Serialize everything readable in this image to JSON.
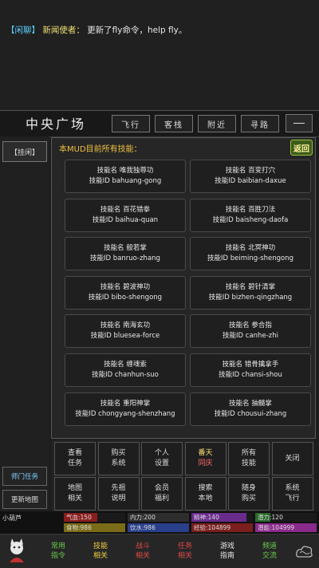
{
  "chat": {
    "channel": "【闲聊】",
    "sender": "新闻使者：",
    "message": "更新了fly命令，help fly。"
  },
  "location": {
    "title": "中央广场",
    "buttons": [
      "飞行",
      "客栈",
      "附近",
      "寻路"
    ]
  },
  "left": {
    "idle": "【挂闲】",
    "sect_task": "师门任务",
    "refresh_map": "更新地图"
  },
  "panel": {
    "title": "本MUD目前所有技能：",
    "close": "返回",
    "name_prefix": "技能名",
    "id_prefix": "技能ID",
    "skills": [
      {
        "name": "唯我独尊功",
        "id": "bahuang-gong"
      },
      {
        "name": "百变打穴",
        "id": "baibian-daxue"
      },
      {
        "name": "百花错拳",
        "id": "baihua-quan"
      },
      {
        "name": "百胜刀法",
        "id": "baisheng-daofa"
      },
      {
        "name": "般若掌",
        "id": "banruo-zhang"
      },
      {
        "name": "北冥神功",
        "id": "beiming-shengong"
      },
      {
        "name": "碧波神功",
        "id": "bibo-shengong"
      },
      {
        "name": "碧针清掌",
        "id": "bizhen-qingzhang"
      },
      {
        "name": "南海玄功",
        "id": "bluesea-force"
      },
      {
        "name": "参合指",
        "id": "canhe-zhi"
      },
      {
        "name": "缠魂索",
        "id": "chanhun-suo"
      },
      {
        "name": "错骨擒拿手",
        "id": "chansi-shou"
      },
      {
        "name": "重阳神掌",
        "id": "chongyang-shenzhang"
      },
      {
        "name": "抽髓掌",
        "id": "chousui-zhang"
      }
    ]
  },
  "commands": [
    {
      "line1": "查看",
      "line2": "任务",
      "highlight": false
    },
    {
      "line1": "购买",
      "line2": "系统",
      "highlight": false
    },
    {
      "line1": "个人",
      "line2": "设置",
      "highlight": false
    },
    {
      "line1": "番天",
      "line2": "同庆",
      "highlight": true
    },
    {
      "line1": "所有",
      "line2": "技能",
      "highlight": false
    },
    {
      "line1": "关闭",
      "line2": "",
      "highlight": false
    },
    {
      "line1": "地图",
      "line2": "相关",
      "highlight": false
    },
    {
      "line1": "先祖",
      "line2": "说明",
      "highlight": false
    },
    {
      "line1": "会员",
      "line2": "福利",
      "highlight": false
    },
    {
      "line1": "搜索",
      "line2": "本地",
      "highlight": false
    },
    {
      "line1": "随身",
      "line2": "购买",
      "highlight": false
    },
    {
      "line1": "系统",
      "line2": "飞行",
      "highlight": false
    }
  ],
  "status": {
    "player": "小葫芦",
    "bars": [
      {
        "label": "气血:150",
        "color": "#8a1e1e",
        "fill": 0.55
      },
      {
        "label": "内力:200",
        "color": "#2d2d2d",
        "fill": 1.0
      },
      {
        "label": "精神:140",
        "color": "#6a2c8c",
        "fill": 0.9
      },
      {
        "label": "潜力:120",
        "color": "#2a6a2a",
        "fill": 0.25
      },
      {
        "label": "食物:986",
        "color": "#7a6b18",
        "fill": 1.0
      },
      {
        "label": "饮水:986",
        "color": "#2a3f8a",
        "fill": 1.0
      },
      {
        "label": "经验:104899",
        "color": "#7a1e1e",
        "fill": 1.0
      },
      {
        "label": "潜能:104999",
        "color": "#8a2a8a",
        "fill": 1.0
      }
    ]
  },
  "nav": [
    {
      "line1": "常用",
      "line2": "指令",
      "color": "#6acb4e"
    },
    {
      "line1": "技能",
      "line2": "相关",
      "color": "#f0d040"
    },
    {
      "line1": "战斗",
      "line2": "相关",
      "color": "#e04848"
    },
    {
      "line1": "任务",
      "line2": "相关",
      "color": "#e04848"
    },
    {
      "line1": "游戏",
      "line2": "指南",
      "color": "#e8e8e8"
    },
    {
      "line1": "频道",
      "line2": "交流",
      "color": "#6acb4e"
    }
  ]
}
